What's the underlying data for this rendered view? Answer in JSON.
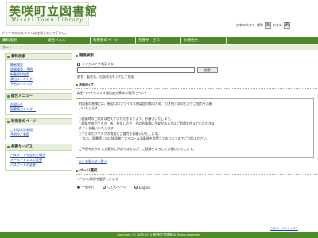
{
  "header": {
    "title": "美咲町立図書館",
    "subtitle": "Misaki Town Library",
    "notice": "ブラウザの戻るボタンは使用しないで下さい。",
    "fontsize_label": "文字の大きさ",
    "fontsize_standard": "標準",
    "fontsize_large": "大きめ",
    "fontsize_button": "あ"
  },
  "nav": {
    "items": [
      {
        "label": "資料検索"
      },
      {
        "label": "総合メニュー"
      },
      {
        "label": "利用者のページ"
      },
      {
        "label": "各種サービス"
      },
      {
        "label": "お問合せ"
      }
    ]
  },
  "breadcrumb": "ホーム",
  "sidebar": {
    "blocks": [
      {
        "title": "資料検索",
        "links": [
          "簡易検索",
          "詳細検索・予約",
          "新着資料検索",
          "貸出ランキング",
          "予約ランキング"
        ]
      },
      {
        "title": "総合メニュー",
        "links": [
          "お知らせ",
          "図書館カレンダー"
        ]
      },
      {
        "title": "利用者のページ",
        "links": [
          "ご利用状況参照",
          "予約かご参照"
        ]
      },
      {
        "title": "各種サービス",
        "links": [
          "パスワードを忘れた場合",
          "メールアドレスの変更",
          "パスワードの変更"
        ]
      }
    ]
  },
  "search": {
    "title": "簡易検索",
    "suggest_label": "サジェストを利用する",
    "input_value": "",
    "input_placeholder": "",
    "button_label": "検索",
    "hint": "書名、著者名、出版者名を入力して検索"
  },
  "notice_section": {
    "title": "お知らせ",
    "subtitle": "新型コロナウイルス感染症対策中の利用について",
    "lines": [
      "利用者の皆様には、新型コロナウイルス感染症対策のため、引き続き次のとおりご協力をお願",
      "いいたします。",
      "",
      "○発熱時のご利用は控えていただきますよう、お願いいたします。",
      "○発熱や咳がでるき、咳、息苦しさや、その他体調に不安がある方はご利用を控えていただきま",
      "すようお願いいたします。",
      "○できるだけマスクの着用にご協力をお願いいたします。",
      "なお、図書館入口に検温機とアルコール消毒器を設置しておりますのでご利用ください。",
      "",
      "ご不便をおかけし大変申し訳ありませんが、ご理解をよろしくお願いいたします。"
    ],
    "more_link": ">> お知らせ一覧へ"
  },
  "page_select": {
    "title": "ページ選択",
    "text": "ページの表示を選択できます",
    "options": [
      {
        "label": "一般向け",
        "selected": true
      },
      {
        "label": "こどもページ",
        "selected": false
      },
      {
        "label": "English",
        "selected": false
      }
    ]
  },
  "pagetop": "このページのトップへ",
  "footer": "Copyright (C) 2008-2010 美咲町立図書館 All Rights Reserved.",
  "colors": {
    "accent": "#4e8a2a",
    "link": "#2348a8",
    "sidebar_head": "#e6efdb"
  },
  "icons": {
    "section_bullet": "square-bullet-icon"
  }
}
